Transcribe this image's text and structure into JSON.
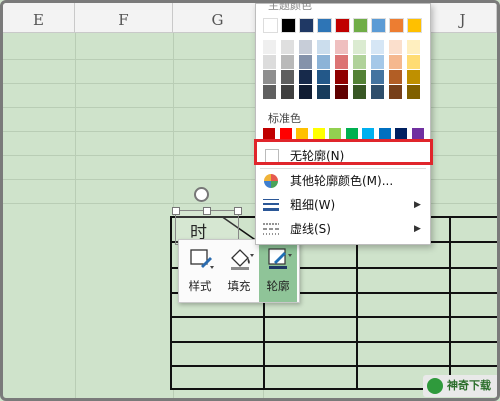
{
  "columns": [
    "E",
    "F",
    "G",
    "",
    "J"
  ],
  "cell_text": "时",
  "mini_toolbar": {
    "style_label": "样式",
    "fill_label": "填充",
    "outline_label": "轮廓"
  },
  "outline_menu": {
    "theme_section_label": "主题颜色",
    "standard_section_label": "标准色",
    "no_outline": "无轮廓(N)",
    "more_colors": "其他轮廓颜色(M)...",
    "weight": "粗细(W)",
    "dash": "虚线(S)"
  },
  "colors": {
    "theme_top": [
      "#ffffff",
      "#000000",
      "#1f3864",
      "#2e75b6",
      "#c00000",
      "#70ad47",
      "#5b9bd5",
      "#ed7d31",
      "#ffc000"
    ],
    "standard": [
      "#c00000",
      "#ff0000",
      "#ffc000",
      "#ffff00",
      "#92d050",
      "#00b050",
      "#00b0f0",
      "#0070c0",
      "#002060",
      "#7030a0"
    ],
    "highlight": "#e0252b",
    "sheet_bg": "#cfe3cb"
  },
  "watermark": "神奇下载"
}
